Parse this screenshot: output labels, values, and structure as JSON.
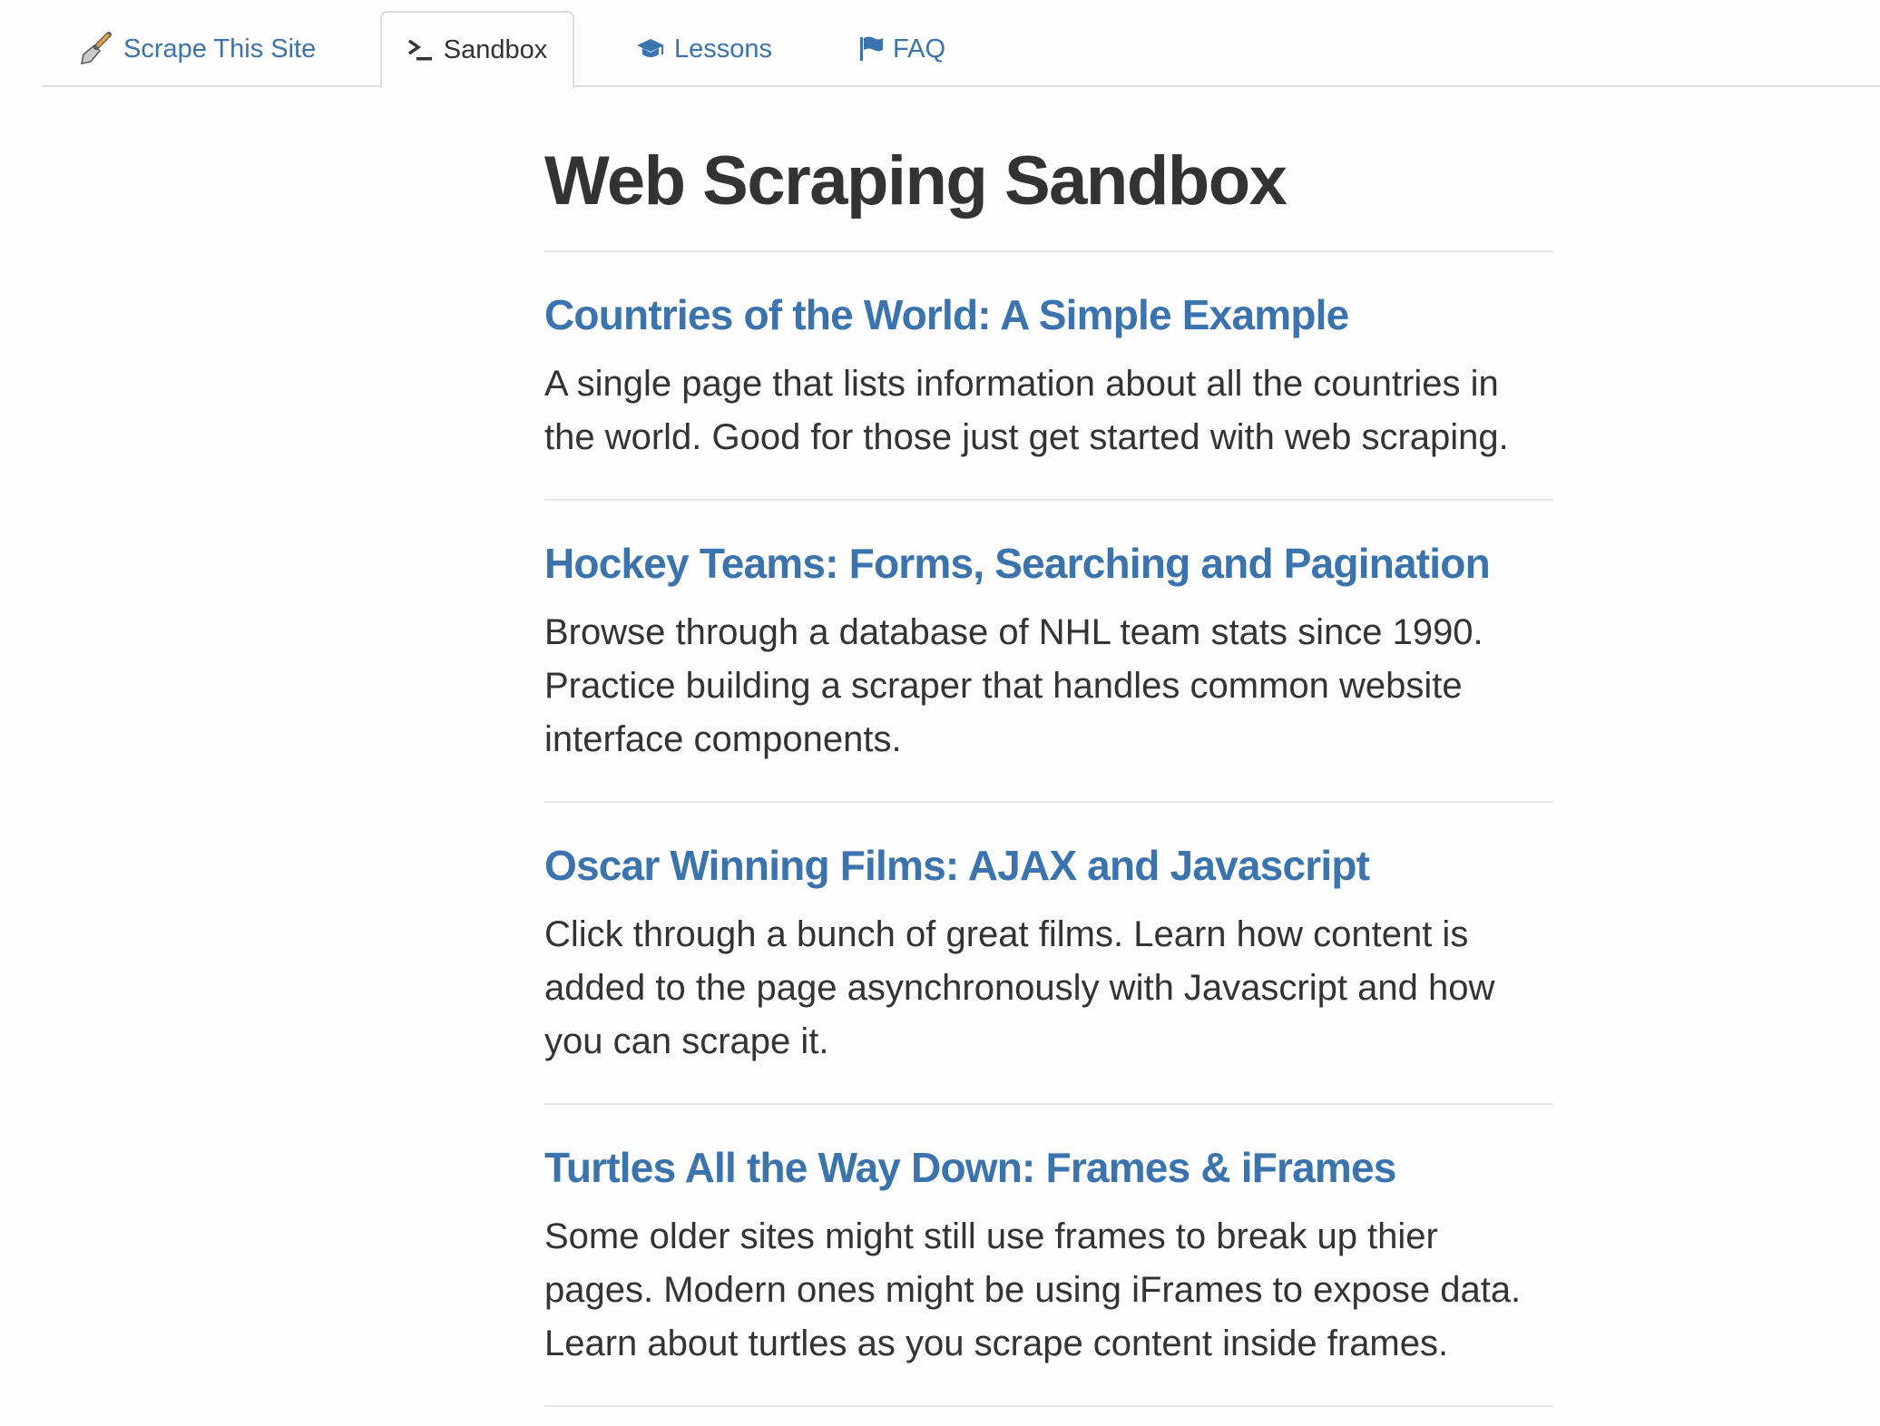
{
  "nav": {
    "tabs": [
      {
        "label": "Scrape This Site",
        "icon": "scraper-tool-icon"
      },
      {
        "label": "Sandbox",
        "icon": "terminal-icon",
        "active": true
      },
      {
        "label": "Lessons",
        "icon": "graduation-cap-icon"
      },
      {
        "label": "FAQ",
        "icon": "flag-icon"
      }
    ]
  },
  "main": {
    "title": "Web Scraping Sandbox",
    "entries": [
      {
        "title": "Countries of the World: A Simple Example",
        "description": "A single page that lists information about all the countries in the world. Good for those just get started with web scraping."
      },
      {
        "title": "Hockey Teams: Forms, Searching and Pagination",
        "description": "Browse through a database of NHL team stats since 1990. Practice building a scraper that handles common website interface components."
      },
      {
        "title": "Oscar Winning Films: AJAX and Javascript",
        "description": "Click through a bunch of great films. Learn how content is added to the page asynchronously with Javascript and how you can scrape it."
      },
      {
        "title": "Turtles All the Way Down: Frames & iFrames",
        "description": "Some older sites might still use frames to break up thier pages. Modern ones might be using iFrames to expose data. Learn about turtles as you scrape content inside frames."
      }
    ]
  },
  "colors": {
    "link": "#3a73ae",
    "text": "#333333",
    "border": "#dddddd",
    "background": "#fdfdfd"
  }
}
